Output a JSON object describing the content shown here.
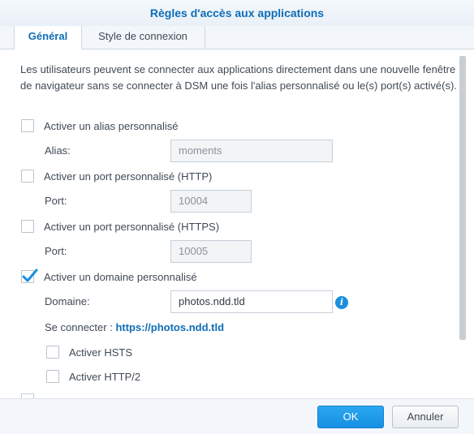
{
  "window": {
    "title": "Règles d'accès aux applications"
  },
  "tabs": [
    {
      "label": "Général",
      "active": true
    },
    {
      "label": "Style de connexion",
      "active": false
    }
  ],
  "description": "Les utilisateurs peuvent se connecter aux applications directement dans une nouvelle fenêtre de navigateur sans se connecter à DSM une fois l'alias personnalisé ou le(s) port(s) activé(s).",
  "alias": {
    "checkbox_label": "Activer un alias personnalisé",
    "checked": false,
    "field_label": "Alias:",
    "value": "moments"
  },
  "http_port": {
    "checkbox_label": "Activer un port personnalisé (HTTP)",
    "checked": false,
    "field_label": "Port:",
    "value": "10004"
  },
  "https_port": {
    "checkbox_label": "Activer un port personnalisé (HTTPS)",
    "checked": false,
    "field_label": "Port:",
    "value": "10005"
  },
  "domain": {
    "checkbox_label": "Activer un domaine personnalisé",
    "checked": true,
    "field_label": "Domaine:",
    "value": "photos.ndd.tld",
    "connect_label": "Se connecter :",
    "connect_url": "https://photos.ndd.tld",
    "info_icon": "info-icon"
  },
  "hsts": {
    "label": "Activer HSTS",
    "checked": false
  },
  "http2": {
    "label": "Activer HTTP/2",
    "checked": false
  },
  "footer": {
    "ok_label": "OK",
    "cancel_label": "Annuler"
  },
  "colors": {
    "accent": "#0e6db7",
    "primary_button": "#1f9be8",
    "check": "#1a8fdc"
  }
}
